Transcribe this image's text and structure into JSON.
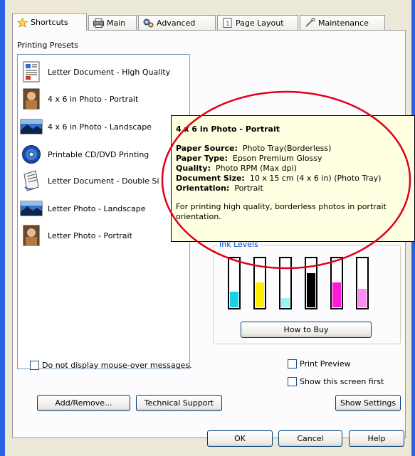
{
  "tabs": [
    {
      "label": "Shortcuts",
      "icon": "star-icon"
    },
    {
      "label": "Main",
      "icon": "printer-icon"
    },
    {
      "label": "Advanced",
      "icon": "gears-icon"
    },
    {
      "label": "Page Layout",
      "icon": "page-icon"
    },
    {
      "label": "Maintenance",
      "icon": "wrench-icon"
    }
  ],
  "presets_title": "Printing Presets",
  "presets": [
    {
      "label": "Letter Document - High Quality",
      "icon": "document-icon"
    },
    {
      "label": "4 x 6 in Photo - Portrait",
      "icon": "photo-portrait-icon"
    },
    {
      "label": "4 x 6 in Photo - Landscape",
      "icon": "photo-landscape-icon"
    },
    {
      "label": "Printable CD/DVD Printing",
      "icon": "cd-icon"
    },
    {
      "label": "Letter Document - Double Si",
      "icon": "duplex-document-icon"
    },
    {
      "label": "Letter Photo - Landscape",
      "icon": "photo-landscape-icon"
    },
    {
      "label": "Letter Photo - Portrait",
      "icon": "photo-portrait-icon"
    }
  ],
  "tooltip": {
    "title": "4 x 6 in Photo - Portrait",
    "rows": [
      {
        "key": "Paper Source:",
        "value": "Photo Tray(Borderless)"
      },
      {
        "key": "Paper Type:",
        "value": "Epson Premium Glossy"
      },
      {
        "key": "Quality:",
        "value": "Photo RPM (Max dpi)"
      },
      {
        "key": "Document Size:",
        "value": "10 x 15 cm (4 x 6 in) (Photo Tray)"
      },
      {
        "key": "Orientation:",
        "value": "Portrait"
      }
    ],
    "description": "For printing high quality, borderless photos in portrait orientation."
  },
  "ink": {
    "legend": "Ink Levels",
    "cartridges": [
      {
        "color": "#19d3e5",
        "level": 0.35
      },
      {
        "color": "#ffee00",
        "level": 0.55
      },
      {
        "color": "#9ef0f5",
        "level": 0.2
      },
      {
        "color": "#000000",
        "level": 0.75
      },
      {
        "color": "#ff1bd8",
        "level": 0.55
      },
      {
        "color": "#f98ef0",
        "level": 0.4
      }
    ],
    "buy_label": "How to Buy"
  },
  "options": {
    "no_mouseover": "Do not display mouse-over messages.",
    "print_preview": "Print Preview",
    "show_first": "Show this screen first"
  },
  "buttons": {
    "add_remove": "Add/Remove...",
    "tech_support": "Technical Support",
    "show_settings": "Show Settings",
    "ok": "OK",
    "cancel": "Cancel",
    "help": "Help"
  }
}
